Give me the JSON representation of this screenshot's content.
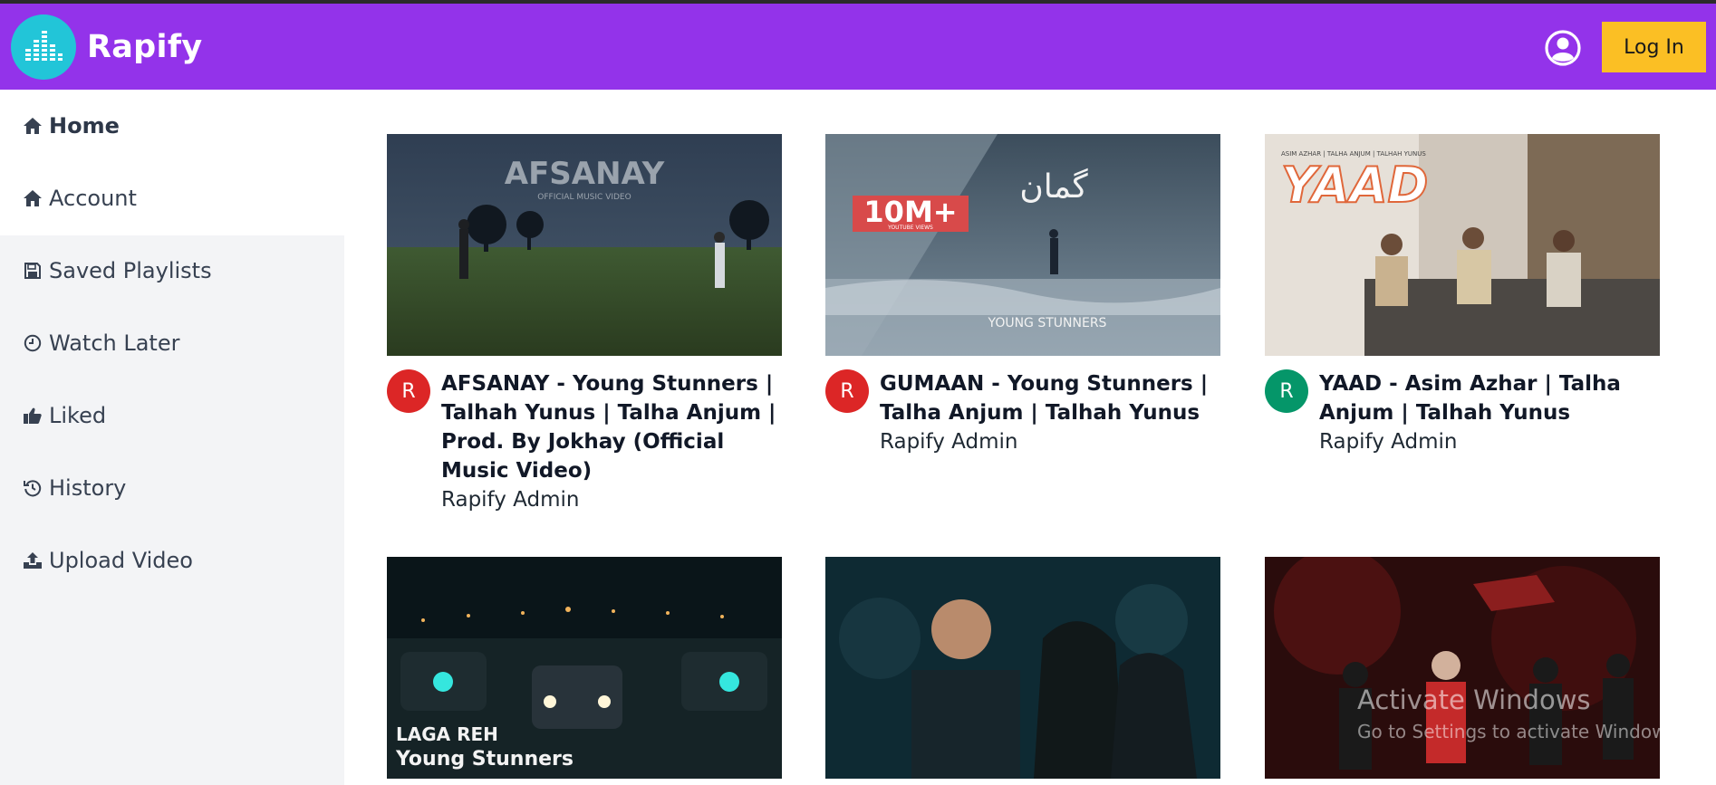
{
  "header": {
    "brand": "Rapify",
    "login_label": "Log In"
  },
  "sidebar": {
    "items": [
      {
        "label": "Home",
        "icon": "home-icon"
      },
      {
        "label": "Account",
        "icon": "home-icon"
      },
      {
        "label": "Saved Playlists",
        "icon": "floppy-disk-icon"
      },
      {
        "label": "Watch Later",
        "icon": "clock-icon"
      },
      {
        "label": "Liked",
        "icon": "thumbs-up-icon"
      },
      {
        "label": "History",
        "icon": "history-icon"
      },
      {
        "label": "Upload Video",
        "icon": "upload-icon"
      }
    ]
  },
  "videos": [
    {
      "title": "AFSANAY - Young Stunners | Talhah Yunus | Talha Anjum | Prod. By Jokhay (Official Music Video)",
      "channel": "Rapify Admin",
      "avatar_letter": "R",
      "avatar_color": "#dc2626",
      "thumb_text": "AFSANAY",
      "thumb_sub": "OFFICIAL MUSIC VIDEO"
    },
    {
      "title": "GUMAAN - Young Stunners | Talha Anjum | Talhah Yunus",
      "channel": "Rapify Admin",
      "avatar_letter": "R",
      "avatar_color": "#dc2626",
      "thumb_text": "YOUNG STUNNERS",
      "thumb_badge": "10M+",
      "thumb_badge_sub": "YOUTUBE VIEWS",
      "thumb_urdu": "گمان"
    },
    {
      "title": "YAAD - Asim Azhar | Talha Anjum | Talhah Yunus",
      "channel": "Rapify Admin",
      "avatar_letter": "R",
      "avatar_color": "#059669",
      "thumb_text": "YAAD",
      "thumb_top": "ASIM AZHAR | TALHA ANJUM | TALHAH YUNUS"
    },
    {
      "thumb_text": "LAGA REH",
      "thumb_sub": "Young Stunners"
    },
    {},
    {}
  ],
  "watermark": {
    "line1": "Activate Windows",
    "line2": "Go to Settings to activate Windows."
  },
  "colors": {
    "navbar": "#9333ea",
    "logo": "#22c5d8",
    "login_button": "#fbbf24",
    "sidebar_bg": "#f3f4f6"
  }
}
